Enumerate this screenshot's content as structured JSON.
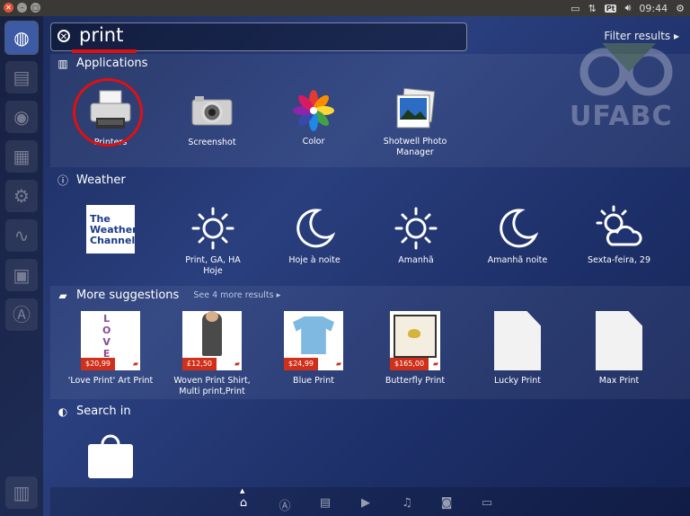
{
  "panel": {
    "keyboard": "Pt",
    "clock": "09:44"
  },
  "search": {
    "query": "print",
    "filter_label": "Filter results"
  },
  "watermark": "UFABC",
  "applications": {
    "title": "Applications",
    "items": [
      {
        "label": "Printers",
        "icon": "printer-icon"
      },
      {
        "label": "Screenshot",
        "icon": "camera-icon"
      },
      {
        "label": "Color",
        "icon": "color-flower-icon"
      },
      {
        "label": "Shotwell Photo Manager",
        "icon": "photo-stack-icon"
      }
    ]
  },
  "weather": {
    "title": "Weather",
    "logo": "The Weather Channel",
    "items": [
      {
        "label": "Print, GA, HA",
        "sub": "Hoje",
        "icon": "sun-icon"
      },
      {
        "label": "Hoje à noite",
        "icon": "moon-icon"
      },
      {
        "label": "Amanhã",
        "icon": "sun-icon"
      },
      {
        "label": "Amanhã noite",
        "icon": "moon-icon"
      },
      {
        "label": "Sexta-feira, 29",
        "icon": "sun-cloud-icon"
      }
    ]
  },
  "suggestions": {
    "title": "More suggestions",
    "more": "See 4 more results",
    "items": [
      {
        "label": "'Love Print' Art Print",
        "price": "$20,99"
      },
      {
        "label": "Woven Print Shirt, Multi print,Print",
        "price": "£12,50"
      },
      {
        "label": "Blue Print",
        "price": "$24,99"
      },
      {
        "label": "Butterfly Print",
        "price": "$165,00"
      },
      {
        "label": "Lucky Print"
      },
      {
        "label": "Max Print"
      }
    ]
  },
  "search_in": {
    "title": "Search in"
  }
}
